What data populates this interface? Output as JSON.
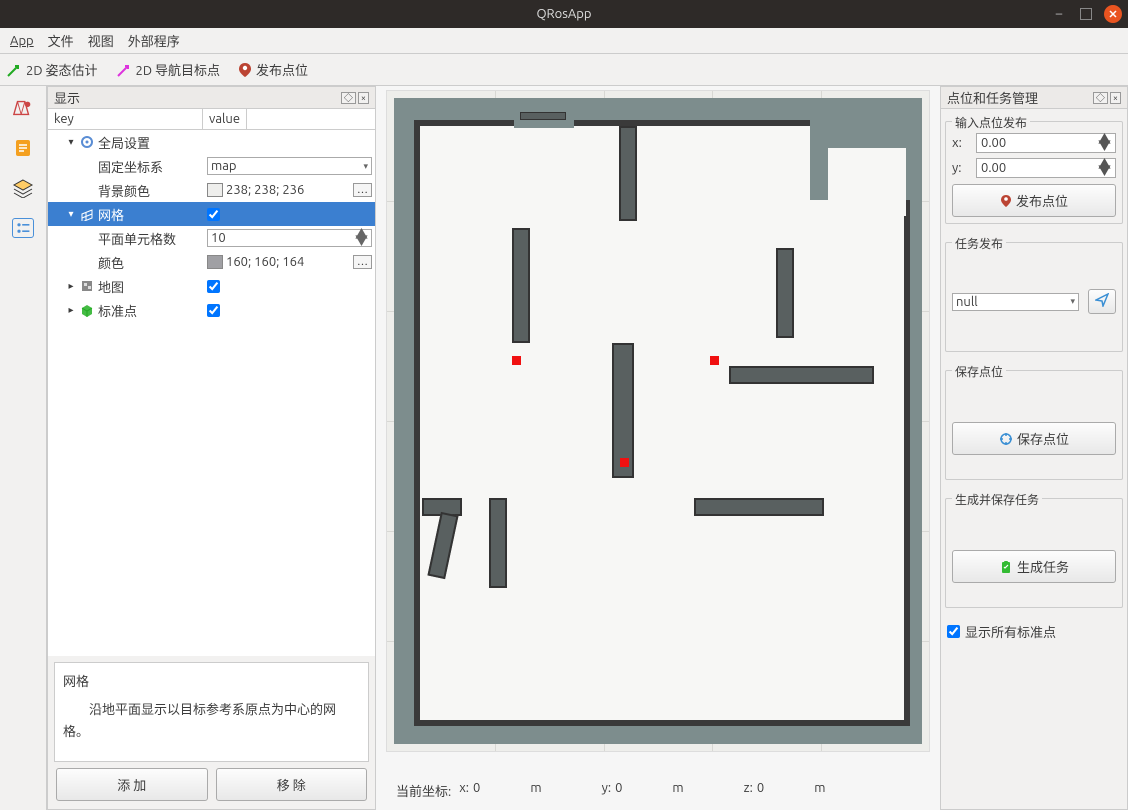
{
  "window": {
    "title": "QRosApp"
  },
  "menu": {
    "app": "App",
    "file": "文件",
    "view": "视图",
    "ext": "外部程序"
  },
  "toolbar": {
    "pose": "2D 姿态估计",
    "nav": "2D 导航目标点",
    "pub": "发布点位"
  },
  "left": {
    "title": "显示",
    "cols": {
      "key": "key",
      "value": "value"
    },
    "global": {
      "label": "全局设置",
      "frame_label": "固定坐标系",
      "frame_value": "map",
      "bg_label": "背景颜色",
      "bg_value": "238; 238; 236",
      "bg_swatch": "#eeeeec"
    },
    "grid": {
      "label": "网格",
      "checked": true,
      "cells_label": "平面单元格数",
      "cells_value": "10",
      "color_label": "颜色",
      "color_value": "160; 160; 164",
      "color_swatch": "#a0a0a4"
    },
    "map_item": {
      "label": "地图",
      "checked": true
    },
    "std_item": {
      "label": "标准点",
      "checked": true
    },
    "desc_title": "网格",
    "desc_text": "沿地平面显示以目标参考系原点为中心的网格。",
    "add": "添 加",
    "remove": "移 除"
  },
  "status": {
    "prefix": "当前坐标:",
    "x_l": "x:",
    "x_v": "0",
    "x_u": "m",
    "y_l": "y:",
    "y_v": "0",
    "y_u": "m",
    "z_l": "z:",
    "z_v": "0",
    "z_u": "m"
  },
  "right": {
    "title": "点位和任务管理",
    "input_group": "输入点位发布",
    "x_l": "x:",
    "x_v": "0.00",
    "y_l": "y:",
    "y_v": "0.00",
    "pub_btn": "发布点位",
    "task_group": "任务发布",
    "task_select": "null",
    "save_group": "保存点位",
    "save_btn": "保存点位",
    "gen_group": "生成并保存任务",
    "gen_btn": "生成任务",
    "show_all": "显示所有标准点"
  },
  "colors": {
    "accent": "#e95420",
    "select": "#3b7fd0"
  }
}
